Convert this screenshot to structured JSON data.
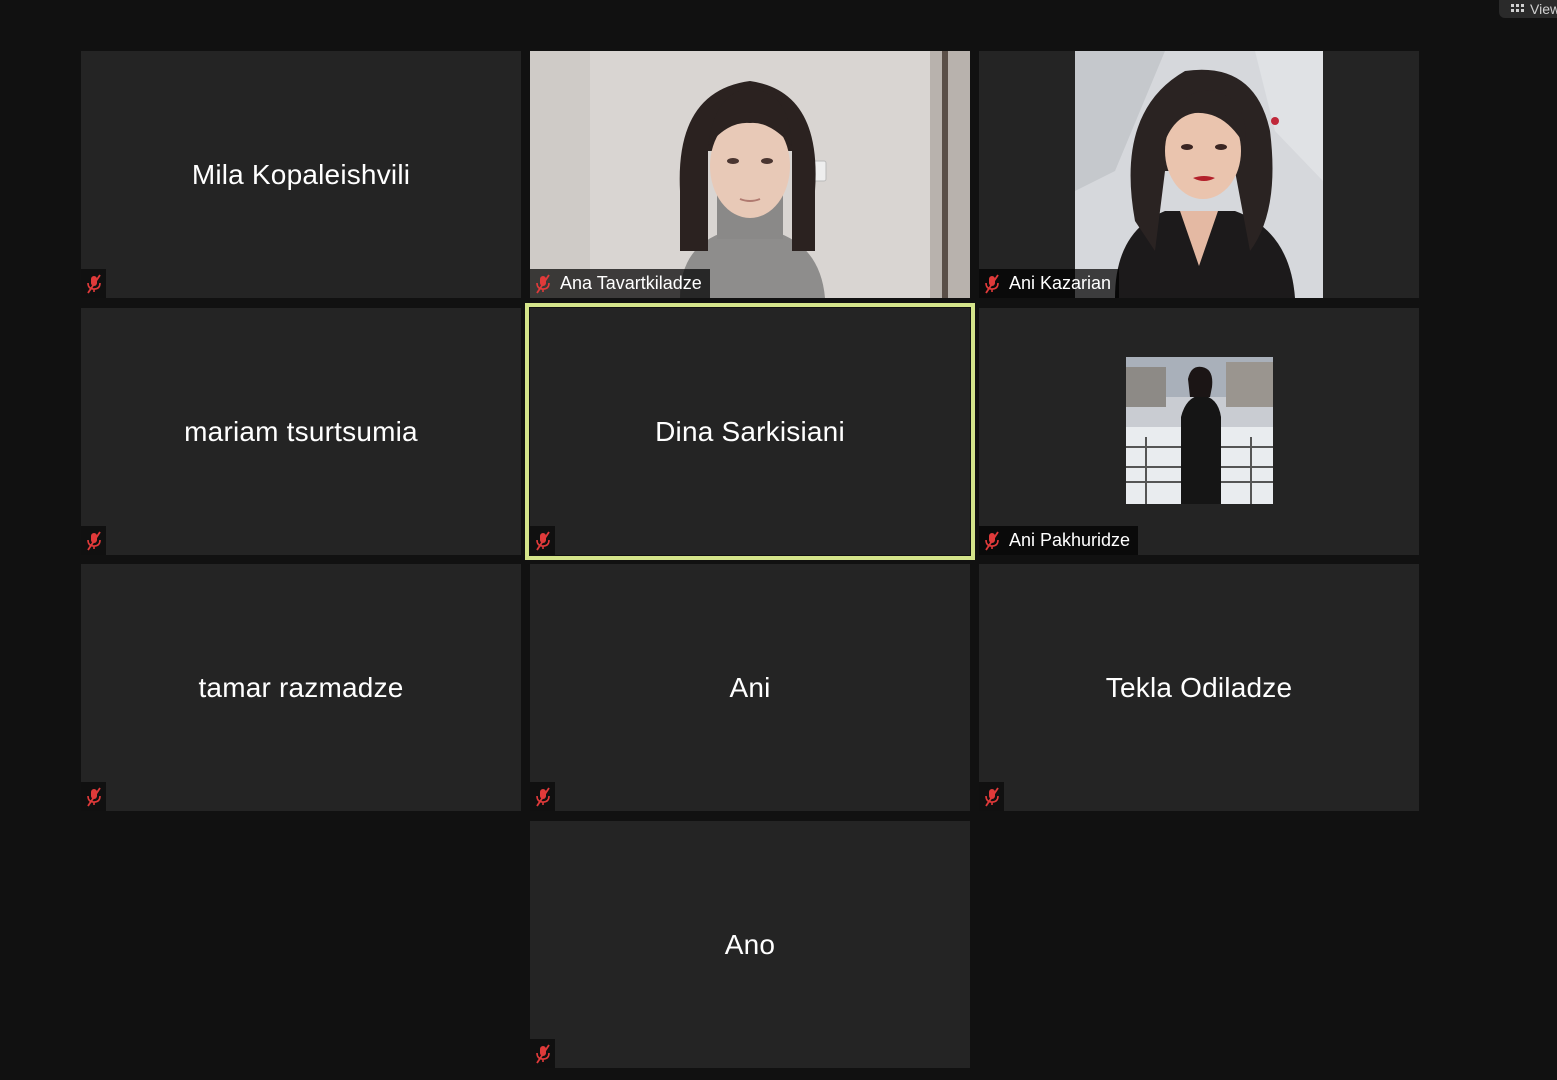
{
  "toolbar": {
    "view_label": "View"
  },
  "colors": {
    "active_speaker_border": "#d4e48a",
    "tile_background": "#242424",
    "page_background": "#111111",
    "muted_icon": "#e03a3a"
  },
  "participants": [
    {
      "name": "Mila Kopaleishvili",
      "video": false,
      "muted": true
    },
    {
      "name": "Ana Tavartkiladze",
      "video": true,
      "muted": true
    },
    {
      "name": "Ani Kazarian",
      "video": true,
      "muted": true
    },
    {
      "name": "mariam tsurtsumia",
      "video": false,
      "muted": true
    },
    {
      "name": "Dina Sarkisiani",
      "video": false,
      "muted": true,
      "active_speaker": true
    },
    {
      "name": "Ani Pakhuridze",
      "video": true,
      "muted": true
    },
    {
      "name": "tamar razmadze",
      "video": false,
      "muted": true
    },
    {
      "name": "Ani",
      "video": false,
      "muted": true
    },
    {
      "name": "Tekla Odiladze",
      "video": false,
      "muted": true
    },
    {
      "name": "Ano",
      "video": false,
      "muted": true
    }
  ]
}
